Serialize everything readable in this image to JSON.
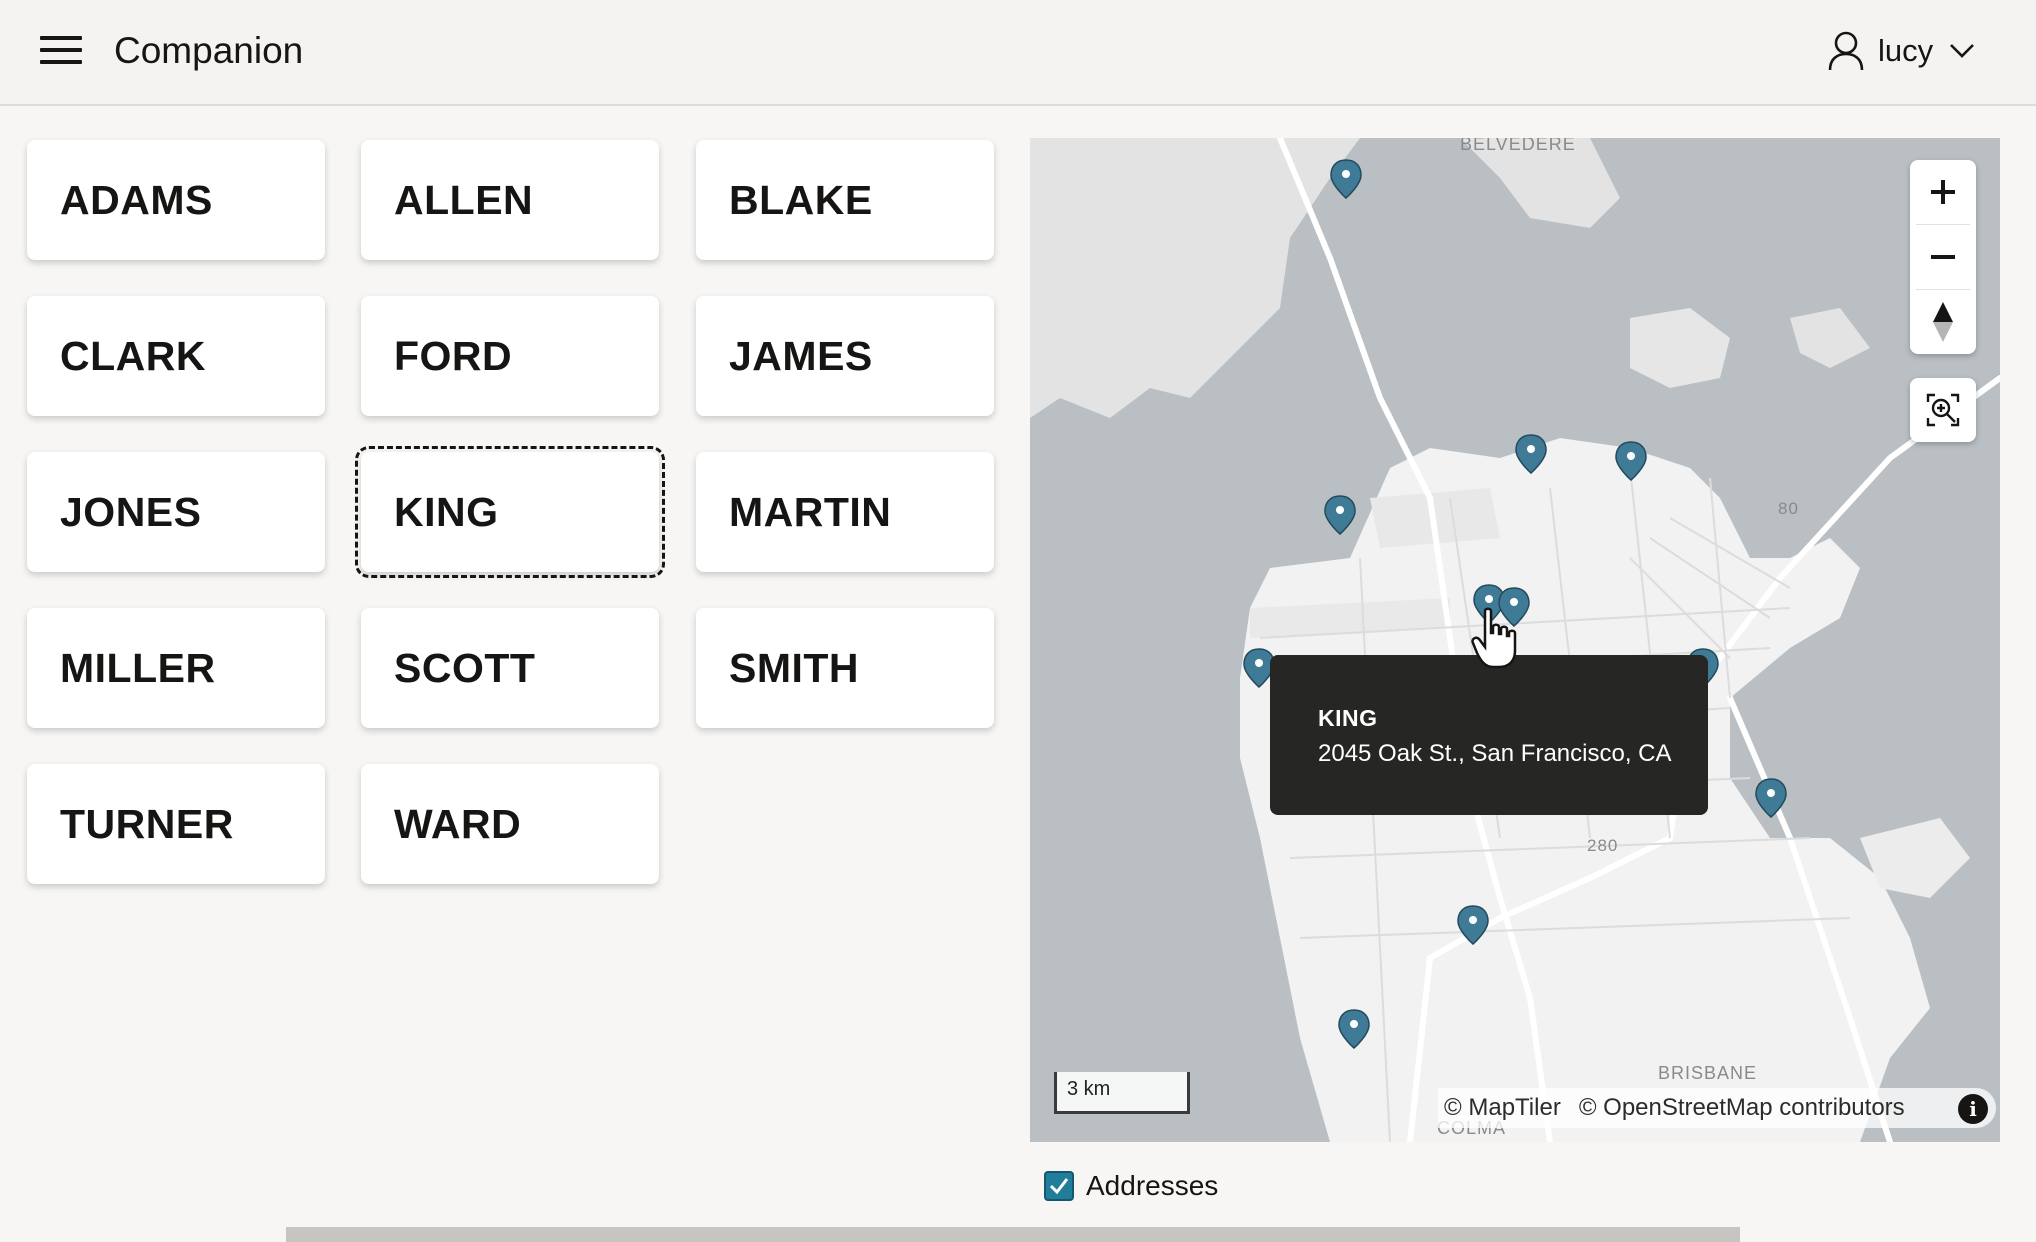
{
  "header": {
    "menu_icon": "hamburger-menu-icon",
    "title": "Companion",
    "user_icon": "user-icon",
    "user_name": "lucy",
    "user_menu_icon": "chevron-down-icon"
  },
  "employees": [
    "ADAMS",
    "ALLEN",
    "BLAKE",
    "CLARK",
    "FORD",
    "JAMES",
    "JONES",
    "KING",
    "MARTIN",
    "MILLER",
    "SCOTT",
    "SMITH",
    "TURNER",
    "WARD"
  ],
  "focused_employee": "KING",
  "map": {
    "place_labels": [
      "BELVEDERE",
      "80",
      "280",
      "BRISBANE",
      "COLMA"
    ],
    "controls": {
      "zoom_in_icon": "plus-icon",
      "zoom_out_icon": "minus-icon",
      "compass_icon": "compass-icon",
      "zoom_to_fit_icon": "zoom-to-fit-icon"
    },
    "scale_label": "3 km",
    "attribution": [
      "© MapTiler",
      "© OpenStreetMap contributors"
    ],
    "info_icon": "info-icon",
    "marker_color": "#3f7a96",
    "popup": {
      "name": "KING",
      "address": "2045 Oak St., San Francisco, CA"
    }
  },
  "addresses_checkbox": {
    "label": "Addresses",
    "checked": true,
    "color": "#227d9b"
  }
}
